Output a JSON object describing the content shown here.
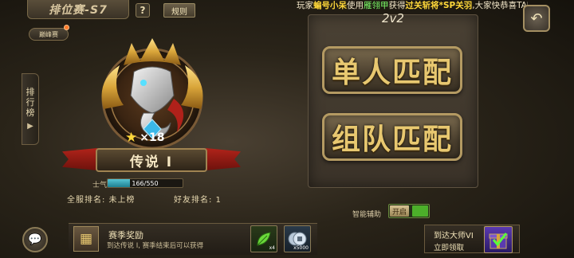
{
  "header": {
    "season_title": "排位赛-S7",
    "help_label": "?",
    "rules_label": "规则",
    "back_icon": "back-arrow-icon",
    "marquee": {
      "prefix": "玩家",
      "player": "蝙号小呆",
      "mid": "使用",
      "item": "雁翎甲",
      "verb": "获得",
      "reward": "过关斩将*SP关羽",
      "suffix": ",大家快恭喜TA吧"
    }
  },
  "left": {
    "peak_label": "巅峰赛",
    "rank_tab_chars": [
      "排",
      "行",
      "榜"
    ],
    "rank_tab_arrow": "▶",
    "stars": "×18",
    "rank_name": "传说 I",
    "morale_label": "士气",
    "morale_current": 166,
    "morale_max": 550,
    "morale_text": "166/550",
    "server_rank": "全服排名: 未上榜",
    "friend_rank": "好友排名: 1"
  },
  "match": {
    "mode": "2v2",
    "solo_label": "单人匹配",
    "team_label": "组队匹配",
    "assist_label": "智能辅助",
    "assist_state": "开启"
  },
  "rewards": {
    "title": "赛季奖励",
    "desc": "到达传说 I, 赛季结束后可以获得",
    "items": [
      {
        "icon": "leaf-icon",
        "qty": "x4"
      },
      {
        "icon": "coin-icon",
        "qty": "x5000"
      }
    ]
  },
  "master": {
    "title": "到达大师VI",
    "claim": "立即领取",
    "icon": "gift-box-icon"
  },
  "colors": {
    "gold": "#e8c870",
    "highlight_yellow": "#ffd83a",
    "highlight_green": "#7dff6a",
    "morale_fill": "#3aa0b4",
    "toggle_green": "#4caf2a"
  }
}
